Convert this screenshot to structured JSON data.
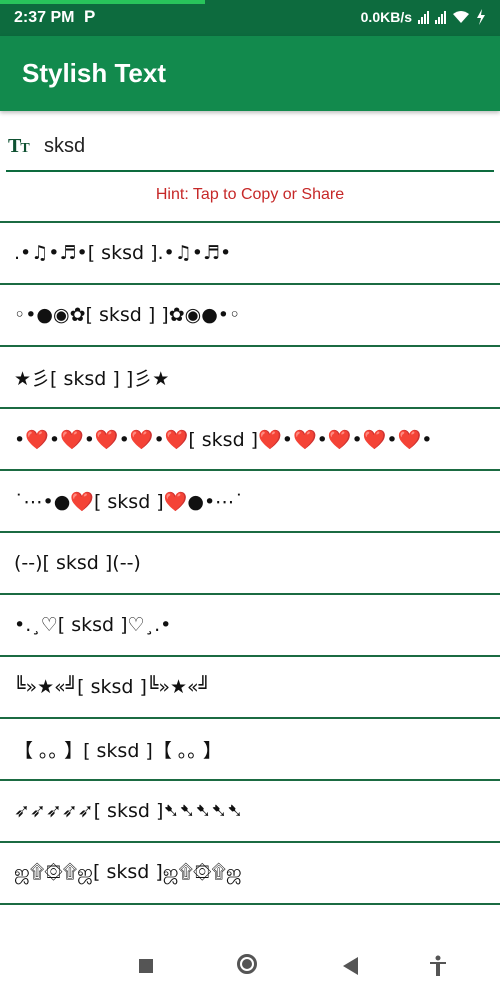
{
  "status_bar": {
    "time": "2:37 PM",
    "app_indicator": "P",
    "network_speed": "0.0KB/s",
    "battery_icon": "battery-charging-icon"
  },
  "app_bar": {
    "title": "Stylish Text"
  },
  "input": {
    "value": "sksd"
  },
  "hint": "Hint: Tap to Copy or Share",
  "styles": [
    ".•♫•♬•[ sksd ].•♫•♬•",
    "◦•●◉✿[ sksd ] ]✿◉●•◦",
    "★彡[ sksd ] ]彡★",
    "•❤️•❤️•❤️•❤️•❤️[ sksd ]❤️•❤️•❤️•❤️•❤️•",
    "˙⋯•●❤️[ sksd ]❤️●•⋯˙",
    "(--)[ sksd ](--)",
    "•.¸♡[ sksd ]♡¸.•",
    "╚»★«╝[ sksd ]╚»★«╝",
    "【 ｡｡ 】[ sksd ]【 ｡｡ 】",
    "➶➶➶➶➶[ sksd ]➷➷➷➷➷",
    "ஜ۩۞۩ஜ[ sksd ]ஜ۩۞۩ஜ"
  ],
  "colors": {
    "status_bar": "#0d6b3e",
    "app_bar": "#128a4d",
    "divider": "#1b6b42",
    "hint": "#c62828"
  },
  "nav": {
    "icons": [
      "recents-square-icon",
      "home-circle-icon",
      "back-triangle-icon",
      "accessibility-icon"
    ]
  }
}
